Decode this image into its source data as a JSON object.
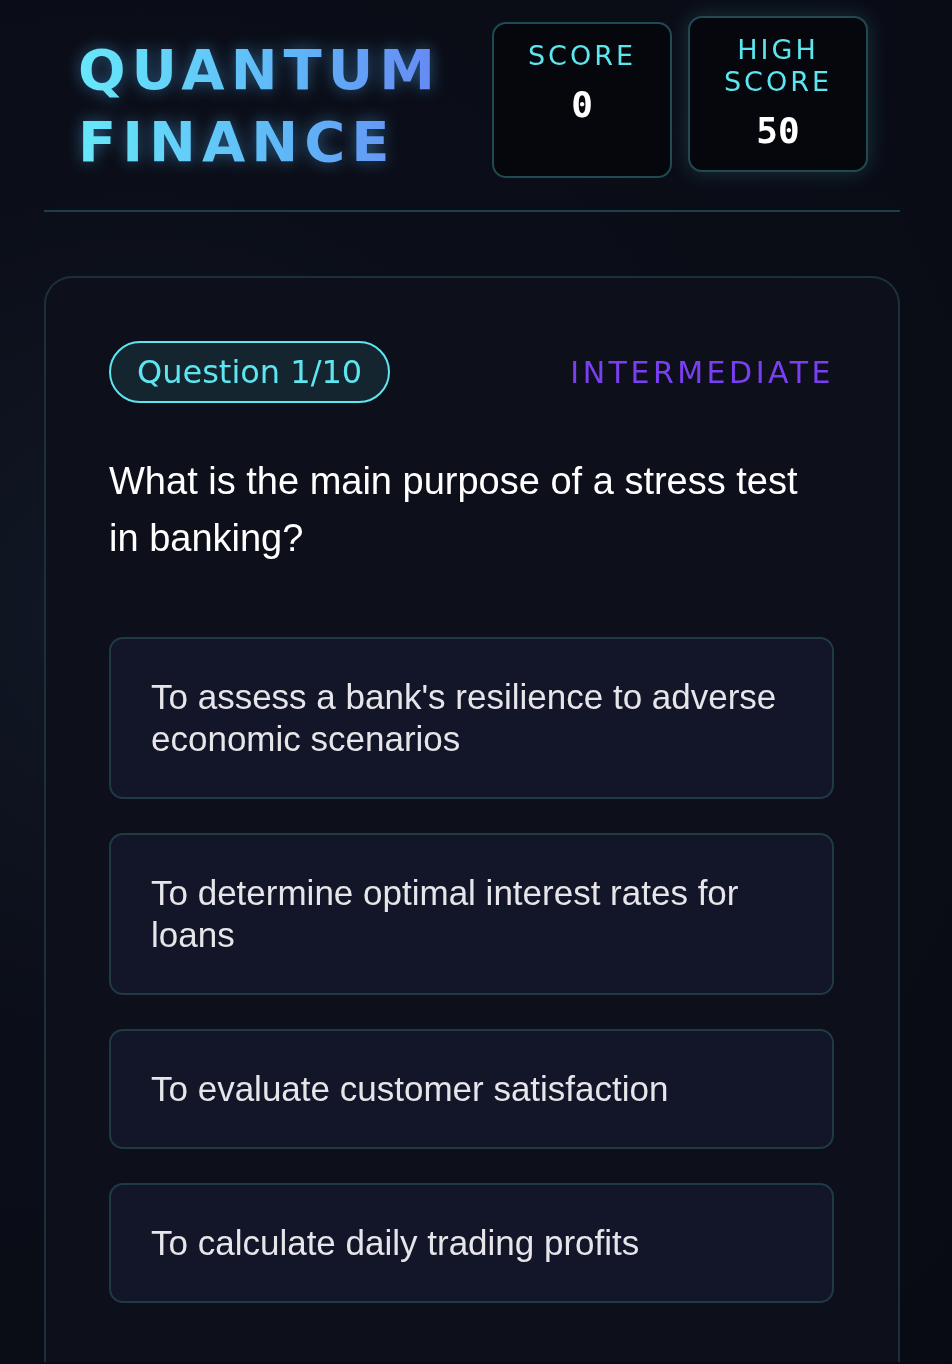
{
  "header": {
    "title": "QUANTUM FINANCE",
    "scores": [
      {
        "label": "SCORE",
        "value": "0",
        "highlighted": false
      },
      {
        "label": "HIGH SCORE",
        "value": "50",
        "highlighted": true
      }
    ]
  },
  "question": {
    "counter": "Question 1/10",
    "difficulty": "INTERMEDIATE",
    "text": "What is the main purpose of a stress test in banking?",
    "options": [
      {
        "text": "To assess a bank's resilience to adverse economic scenarios",
        "selected": false
      },
      {
        "text": "To determine optimal interest rates for loans",
        "selected": false
      },
      {
        "text": "To evaluate customer satisfaction",
        "selected": false
      },
      {
        "text": "To calculate daily trading profits",
        "selected": false
      }
    ]
  }
}
